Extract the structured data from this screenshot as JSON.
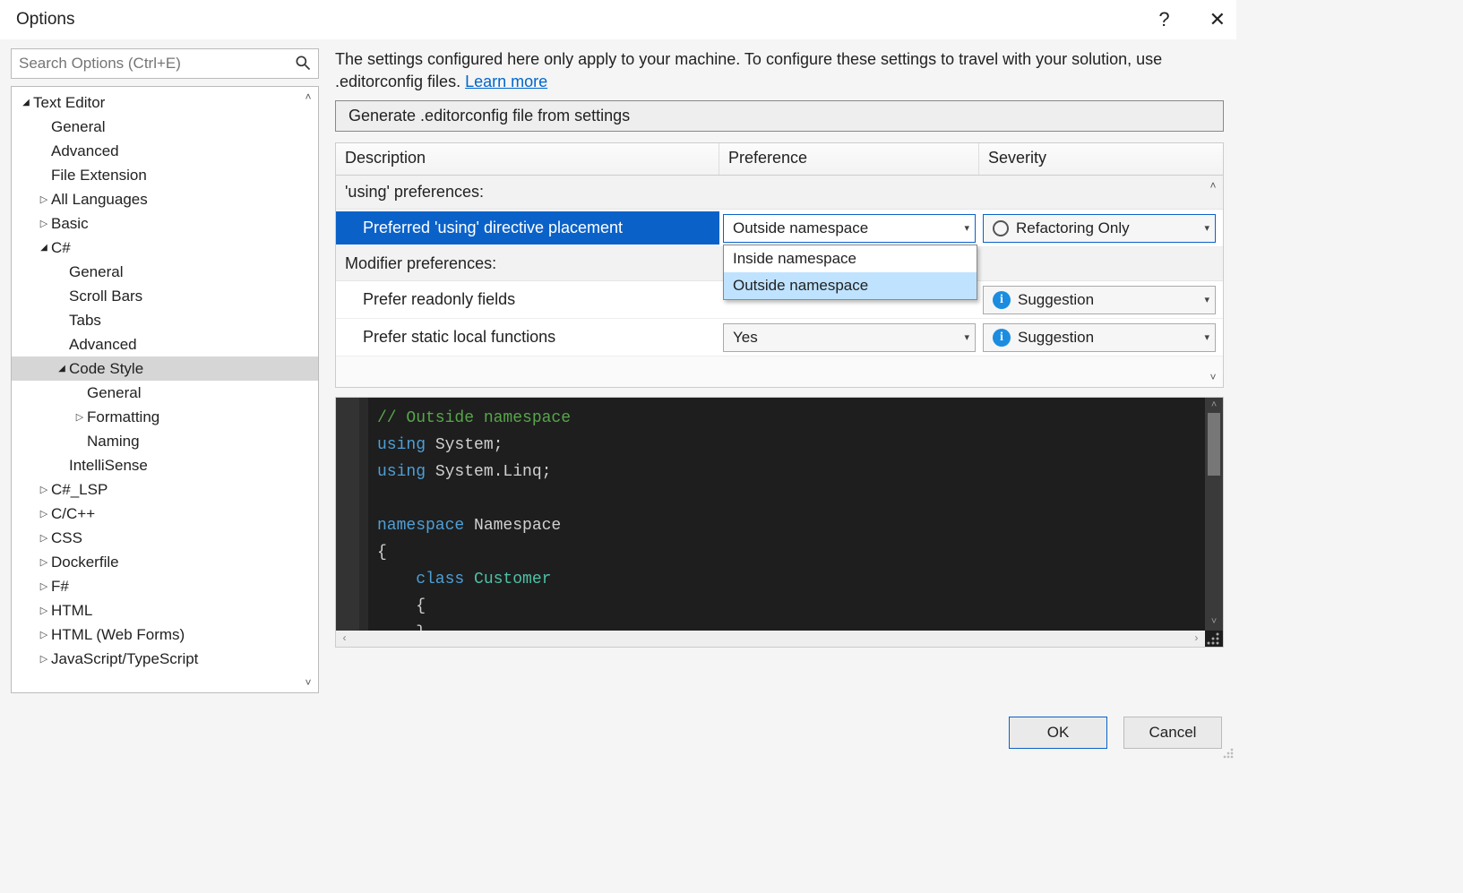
{
  "window": {
    "title": "Options",
    "help": "?",
    "close": "✕"
  },
  "search": {
    "placeholder": "Search Options (Ctrl+E)"
  },
  "tree": [
    {
      "label": "Text Editor",
      "level": 0,
      "arrow": "down"
    },
    {
      "label": "General",
      "level": 1,
      "arrow": "none"
    },
    {
      "label": "Advanced",
      "level": 1,
      "arrow": "none"
    },
    {
      "label": "File Extension",
      "level": 1,
      "arrow": "none"
    },
    {
      "label": "All Languages",
      "level": 1,
      "arrow": "right"
    },
    {
      "label": "Basic",
      "level": 1,
      "arrow": "right"
    },
    {
      "label": "C#",
      "level": 1,
      "arrow": "down"
    },
    {
      "label": "General",
      "level": 2,
      "arrow": "none"
    },
    {
      "label": "Scroll Bars",
      "level": 2,
      "arrow": "none"
    },
    {
      "label": "Tabs",
      "level": 2,
      "arrow": "none"
    },
    {
      "label": "Advanced",
      "level": 2,
      "arrow": "none"
    },
    {
      "label": "Code Style",
      "level": 2,
      "arrow": "down",
      "selected": true
    },
    {
      "label": "General",
      "level": 3,
      "arrow": "none"
    },
    {
      "label": "Formatting",
      "level": 3,
      "arrow": "right"
    },
    {
      "label": "Naming",
      "level": 3,
      "arrow": "none"
    },
    {
      "label": "IntelliSense",
      "level": 2,
      "arrow": "none"
    },
    {
      "label": "C#_LSP",
      "level": 1,
      "arrow": "right"
    },
    {
      "label": "C/C++",
      "level": 1,
      "arrow": "right"
    },
    {
      "label": "CSS",
      "level": 1,
      "arrow": "right"
    },
    {
      "label": "Dockerfile",
      "level": 1,
      "arrow": "right"
    },
    {
      "label": "F#",
      "level": 1,
      "arrow": "right"
    },
    {
      "label": "HTML",
      "level": 1,
      "arrow": "right"
    },
    {
      "label": "HTML (Web Forms)",
      "level": 1,
      "arrow": "right"
    },
    {
      "label": "JavaScript/TypeScript",
      "level": 1,
      "arrow": "right"
    }
  ],
  "info": {
    "text": "The settings configured here only apply to your machine. To configure these settings to travel with your solution, use .editorconfig files.  ",
    "link": "Learn more"
  },
  "generateButton": "Generate .editorconfig file from settings",
  "grid": {
    "headers": {
      "desc": "Description",
      "pref": "Preference",
      "sev": "Severity"
    },
    "group1": "'using' preferences:",
    "row1": {
      "desc": "Preferred 'using' directive placement",
      "pref": "Outside namespace",
      "sev": "Refactoring Only"
    },
    "dropdown": {
      "opt1": "Inside namespace",
      "opt2": "Outside namespace"
    },
    "group2": "Modifier preferences:",
    "row2": {
      "desc": "Prefer readonly fields",
      "sev": "Suggestion"
    },
    "row3": {
      "desc": "Prefer static local functions",
      "pref": "Yes",
      "sev": "Suggestion"
    }
  },
  "code": {
    "l1a": "// Outside namespace",
    "l2a": "using",
    "l2b": " System;",
    "l3a": "using",
    "l3b": " System.Linq;",
    "l4": "",
    "l5a": "namespace",
    "l5b": " Namespace",
    "l6": "{",
    "l7a": "    class",
    "l7b": " Customer",
    "l8": "    {",
    "l9": "    }"
  },
  "buttons": {
    "ok": "OK",
    "cancel": "Cancel"
  }
}
